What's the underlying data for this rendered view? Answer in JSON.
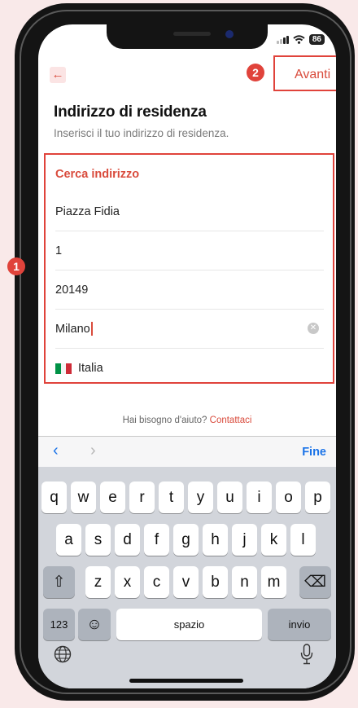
{
  "status": {
    "battery": "86"
  },
  "header": {
    "back_icon": "←",
    "next_label": "Avanti"
  },
  "annotations": {
    "badge_1": "1",
    "badge_2": "2"
  },
  "page": {
    "title": "Indirizzo di residenza",
    "subtitle": "Inserisci il tuo indirizzo di residenza."
  },
  "address": {
    "search_label": "Cerca indirizzo",
    "street": "Piazza Fidia",
    "number": "1",
    "cap": "20149",
    "city": "Milano",
    "country": "Italia",
    "flag_colors": [
      "#009246",
      "#ffffff",
      "#ce2b37"
    ]
  },
  "help": {
    "text": "Hai bisogno d'aiuto? ",
    "link": "Contattaci"
  },
  "keyboard": {
    "prev_icon": "‹",
    "next_icon": "›",
    "done_label": "Fine",
    "row1": [
      "q",
      "w",
      "e",
      "r",
      "t",
      "y",
      "u",
      "i",
      "o",
      "p"
    ],
    "row2": [
      "a",
      "s",
      "d",
      "f",
      "g",
      "h",
      "j",
      "k",
      "l"
    ],
    "row3": [
      "z",
      "x",
      "c",
      "v",
      "b",
      "n",
      "m"
    ],
    "shift_icon": "⇧",
    "backspace_icon": "⌫",
    "numbers_label": "123",
    "emoji_icon": "☺",
    "space_label": "spazio",
    "return_label": "invio"
  },
  "colors": {
    "accent": "#d94b3c",
    "annotation": "#e0433b",
    "ios_blue": "#1a73e8"
  }
}
